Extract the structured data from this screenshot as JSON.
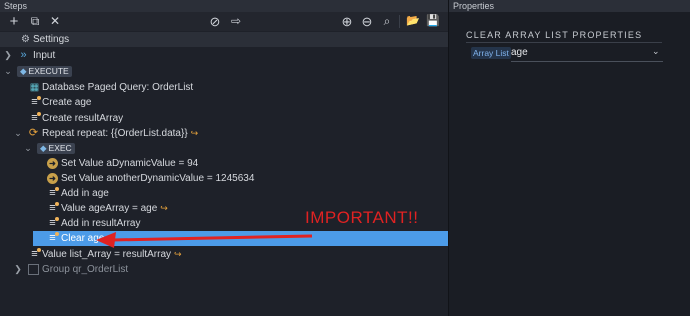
{
  "steps_panel": {
    "title": "Steps",
    "toolbar": {
      "add": "+",
      "copy": "⧉",
      "delete": "✕",
      "disable": "⊘",
      "goto": "⇨",
      "zoom_in": "⊕",
      "zoom_out": "⊖",
      "zoom_fit": "⌕",
      "open": "📂",
      "save": "💾"
    },
    "rows": {
      "settings": "Settings",
      "input": "Input",
      "execute": "EXECUTE",
      "db_query": "Database Paged Query: OrderList",
      "create_age": "Create age",
      "create_result": "Create resultArray",
      "repeat": "Repeat repeat: {{OrderList.data}}",
      "exec": "EXEC",
      "set_adv": "Set Value aDynamicValue = 94",
      "set_another": "Set Value anotherDynamicValue = 1245634",
      "add_age": "Add in age",
      "value_age_array": "Value ageArray = age",
      "add_result": "Add in resultArray",
      "clear_age": "Clear age",
      "value_list_array": "Value list_Array = resultArray",
      "group": "Group qr_OrderList"
    }
  },
  "properties_panel": {
    "title": "Properties",
    "section_title": "CLEAR ARRAY LIST PROPERTIES",
    "field_label": "Array List",
    "field_value": "age"
  },
  "annotation": {
    "text": "IMPORTANT!!",
    "color": "#e02222"
  },
  "colors": {
    "selection": "#4c9be8",
    "accent_orange": "#e6a23c"
  }
}
